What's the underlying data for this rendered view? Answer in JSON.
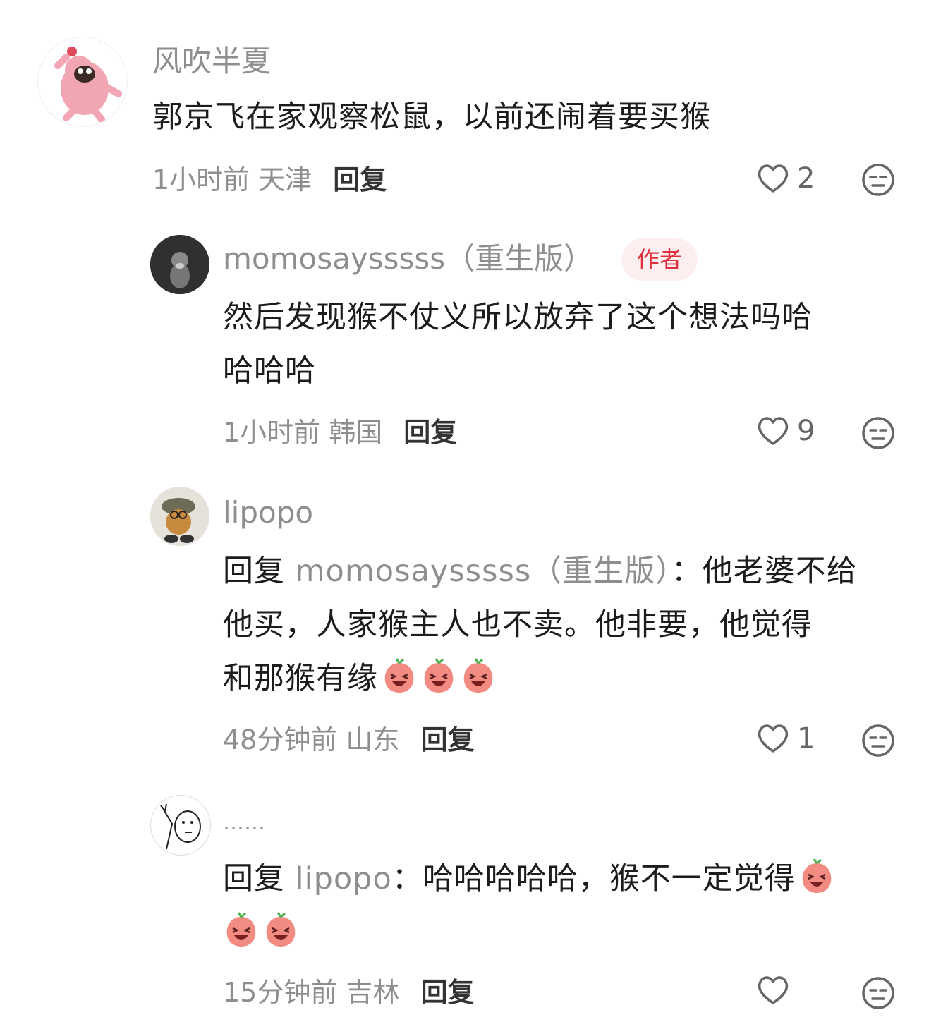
{
  "comments": [
    {
      "user": "风吹半夏",
      "text": "郭京飞在家观察松鼠，以前还闹着要买猴",
      "time_location": "1小时前 天津",
      "reply_label": "回复",
      "likes": "2"
    },
    {
      "user": "momosaysssss（重生版）",
      "badge": "作者",
      "text_line1": "然后发现猴不仗义所以放弃了这个想法吗哈",
      "text_line2": "哈哈哈",
      "time_location": "1小时前 韩国",
      "reply_label": "回复",
      "likes": "9"
    },
    {
      "user": "lipopo",
      "reply_prefix": "回复",
      "reply_to": "momosaysssss（重生版）",
      "colon": "：",
      "text_line1_tail": "他老婆不给",
      "text_line2": "他买，人家猴主人也不卖。他非要，他觉得",
      "text_line3": "和那猴有缘",
      "time_location": "48分钟前 山东",
      "reply_label": "回复",
      "likes": "1"
    },
    {
      "user": "……",
      "reply_prefix": "回复",
      "reply_to": "lipopo",
      "colon": "：",
      "text_line1_tail": "哈哈哈哈哈，猴不一定觉得",
      "time_location": "15分钟前 吉林",
      "reply_label": "回复"
    }
  ],
  "icons": {
    "like": "heart-outline-icon",
    "dislike": "meh-face-icon",
    "emoji": "peach-laugh-emoji"
  },
  "colors": {
    "author_badge_bg": "#fdeff0",
    "author_badge_text": "#e0303e",
    "secondary_text": "#8e8e8e"
  }
}
